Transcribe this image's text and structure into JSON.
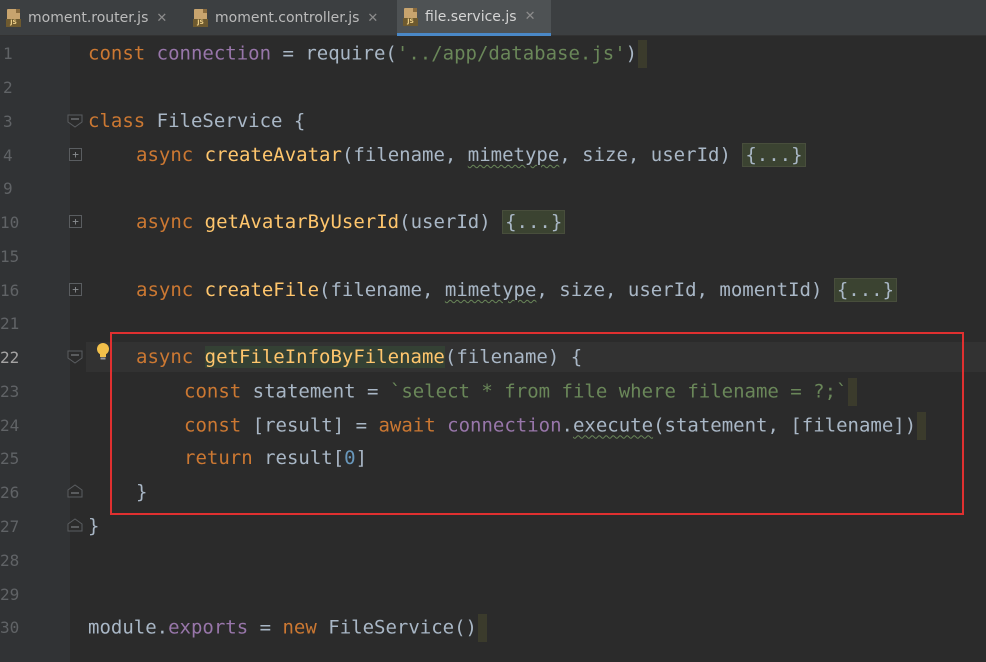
{
  "tabs": [
    {
      "label": "moment.router.js",
      "icon": "js-file-icon",
      "badge": "JS",
      "active": false
    },
    {
      "label": "moment.controller.js",
      "icon": "js-file-icon",
      "badge": "JS",
      "active": false
    },
    {
      "label": "file.service.js",
      "icon": "js-file-icon",
      "badge": "JS",
      "active": true
    }
  ],
  "tab_close_glyph": "✕",
  "line_numbers": [
    "1",
    "2",
    "3",
    "4",
    "9",
    "10",
    "15",
    "16",
    "21",
    "22",
    "23",
    "24",
    "25",
    "26",
    "27",
    "28",
    "29",
    "30"
  ],
  "current_line_number": "22",
  "code": {
    "l1_const": "const",
    "l1_name": "connection",
    "l1_eq": " = require(",
    "l1_str": "'../app/database.js'",
    "l1_end": ")",
    "l3_class": "class",
    "l3_name": " FileService {",
    "async": "async",
    "m1_name": "createAvatar",
    "m1_args_a": "(filename, ",
    "m1_args_b": "mimetype",
    "m1_args_c": ", size, userId) ",
    "fold_pill": "{...}",
    "m2_name": "getAvatarByUserId",
    "m2_args": "(userId) ",
    "m3_name": "createFile",
    "m3_args_a": "(filename, ",
    "m3_args_b": "mimetype",
    "m3_args_c": ", size, userId, momentId) ",
    "m4_name": "getFileInfoByFilename",
    "m4_args": "(filename) {",
    "l23_const": "const",
    "l23_mid": " statement = ",
    "l23_str": "`select * from file where filename = ?;`",
    "l24_const": "const",
    "l24_mid": " [result] = ",
    "l24_await": "await",
    "l24_conn": "connection",
    "l24_dot": ".",
    "l24_exec": "execute",
    "l24_args": "(statement, [filename])",
    "l25_return": "return",
    "l25_mid": " result[",
    "l25_num": "0",
    "l25_end": "]",
    "l26": "}",
    "l27": "}",
    "l30_module": "module.",
    "l30_exports": "exports",
    "l30_eq": " = ",
    "l30_new": "new",
    "l30_end": " FileService()"
  },
  "colors": {
    "background": "#2b2b2b",
    "keyword": "#cc7832",
    "function": "#ffc66d",
    "identifier": "#9876aa",
    "string": "#6a8759",
    "number": "#6897bb",
    "text": "#a9b7c6",
    "highlight_box": "#e03030",
    "active_tab_underline": "#4a88c7"
  },
  "icons": {
    "lightbulb": "intention-bulb-icon",
    "fold_expand": "fold-expand-icon",
    "fold_collapse": "fold-collapse-icon"
  }
}
